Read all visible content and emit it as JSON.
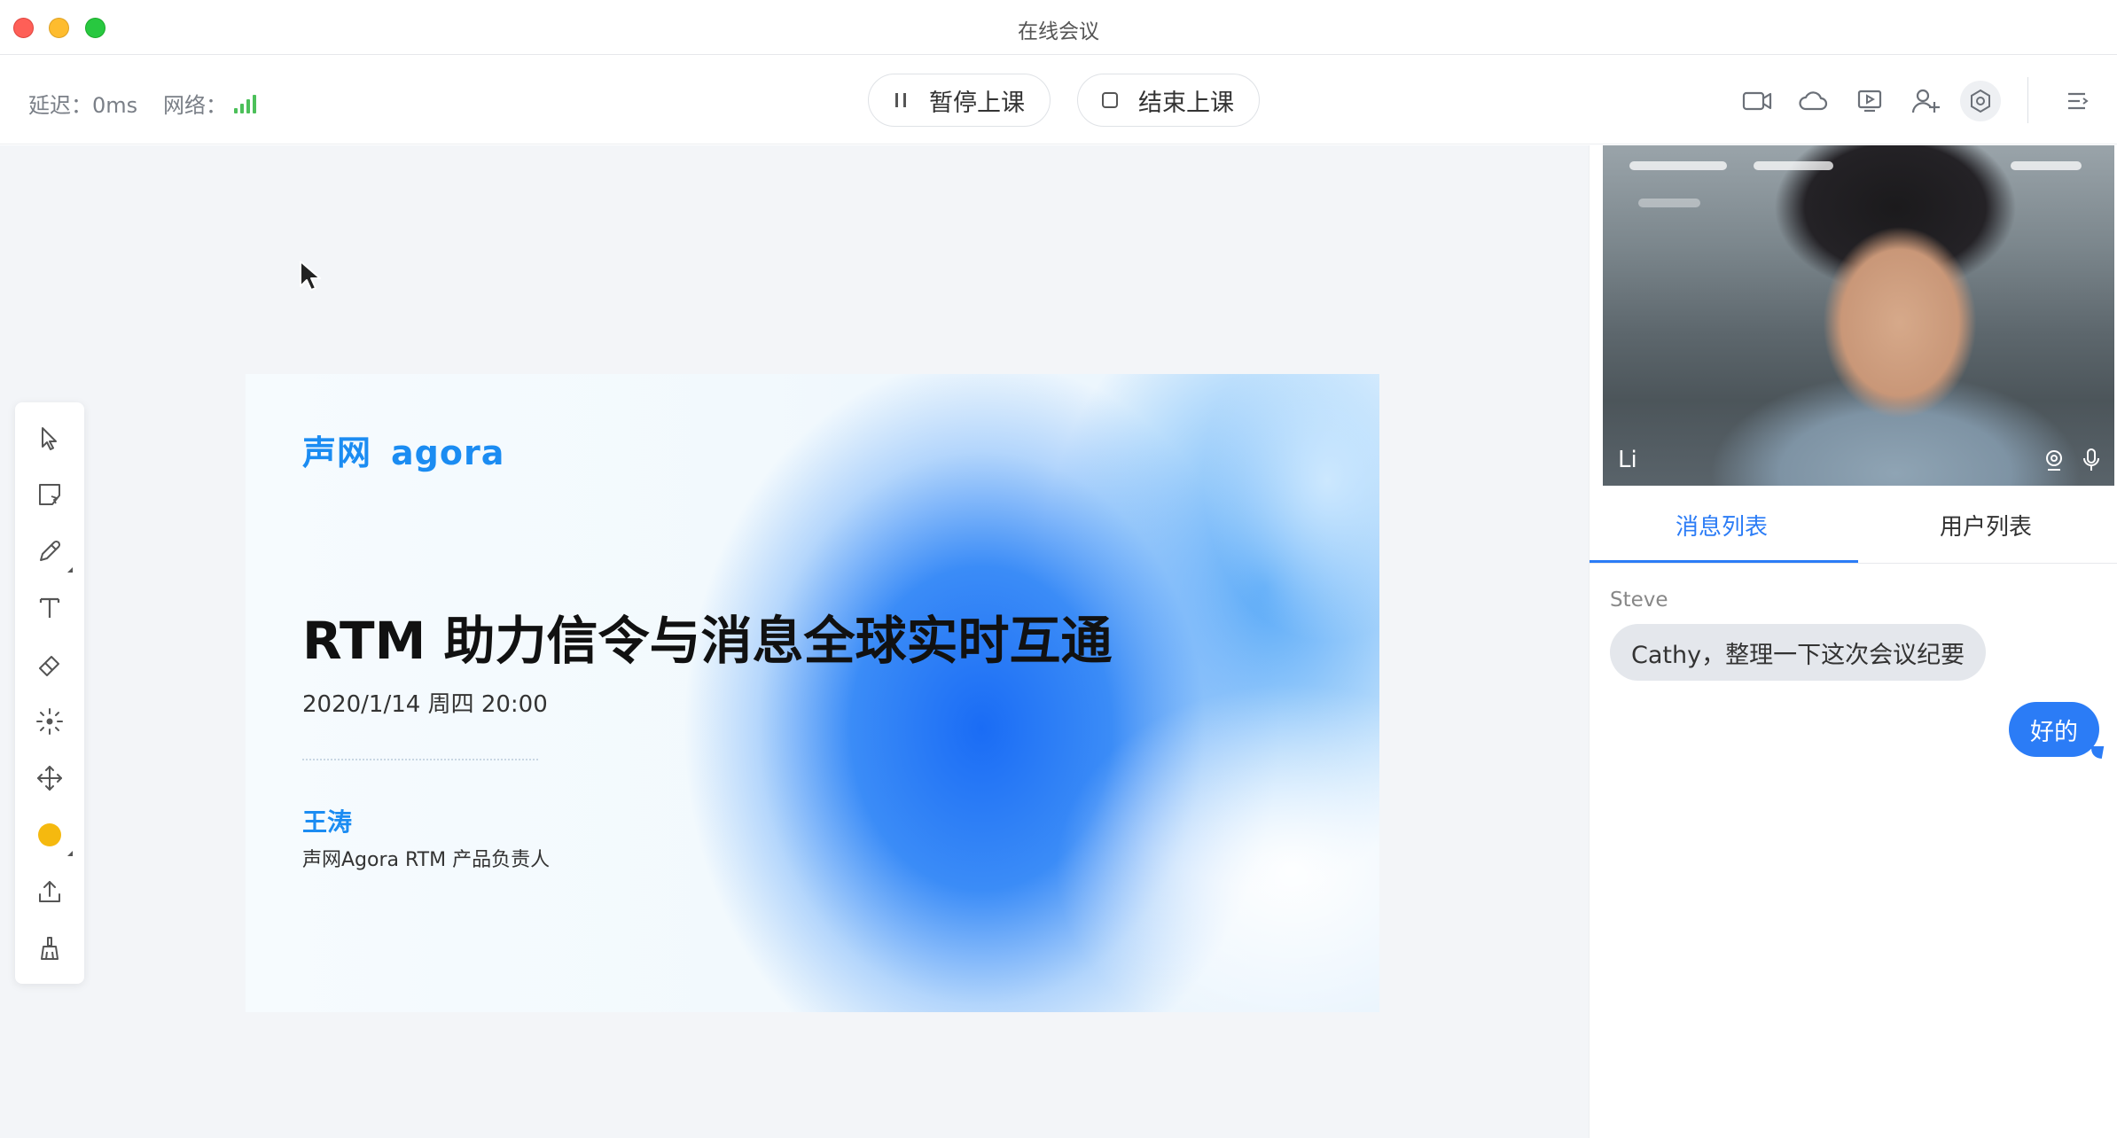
{
  "window": {
    "title": "在线会议"
  },
  "topbar": {
    "latency_label": "延迟：",
    "latency_value": "0ms",
    "network_label": "网络：",
    "pause_label": "暂停上课",
    "end_label": "结束上课",
    "icons": [
      "camera-icon",
      "cloud-icon",
      "screen-share-icon",
      "add-user-icon",
      "settings-icon",
      "menu-icon"
    ]
  },
  "toolbar": {
    "tools": [
      "select-tool",
      "sticky-note-tool",
      "pencil-tool",
      "text-tool",
      "eraser-tool",
      "laser-pointer-tool",
      "move-tool",
      "color-picker-tool",
      "upload-tool",
      "clear-tool"
    ],
    "current_color": "#f5b90f"
  },
  "slide": {
    "logo_cn": "声网",
    "logo_en": "agora",
    "title": "RTM 助力信令与消息全球实时互通",
    "date": "2020/1/14 周四 20:00",
    "speaker_name": "王涛",
    "speaker_role": "声网Agora RTM 产品负责人"
  },
  "video": {
    "name": "Li"
  },
  "tabs": [
    {
      "label": "消息列表",
      "active": true
    },
    {
      "label": "用户列表",
      "active": false
    }
  ],
  "messages": [
    {
      "sender": "Steve",
      "text": "Cathy，整理一下这次会议纪要",
      "side": "left"
    },
    {
      "sender": "",
      "text": "好的",
      "side": "right"
    }
  ],
  "colors": {
    "accent": "#2b7cf6",
    "signal": "#4cc05a",
    "brand": "#1b8cf2"
  }
}
